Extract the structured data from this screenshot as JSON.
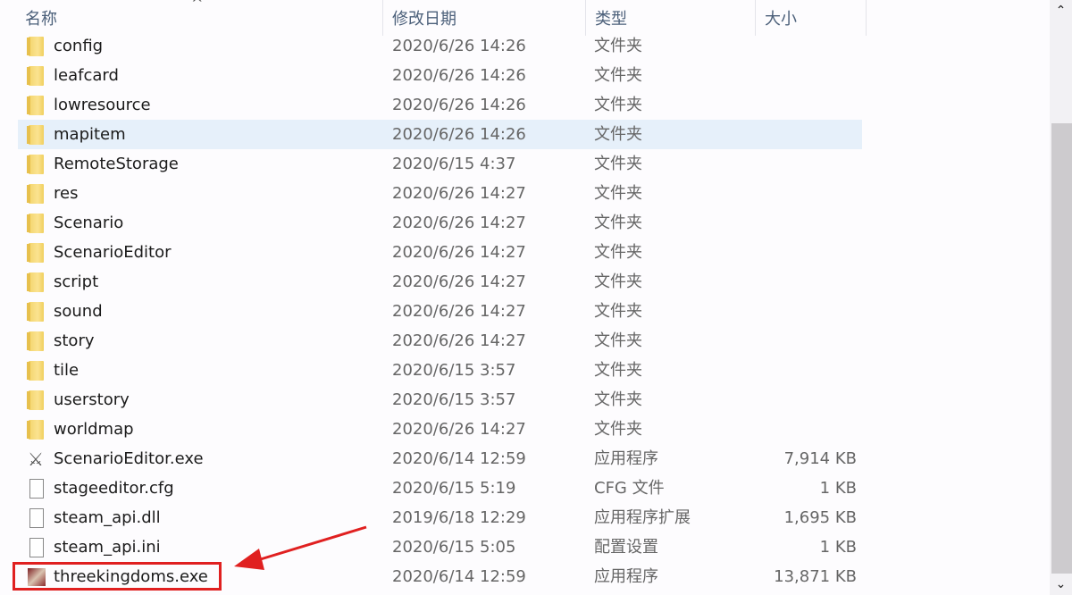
{
  "columns": {
    "name": "名称",
    "date": "修改日期",
    "type": "类型",
    "size": "大小"
  },
  "files": [
    {
      "name": "config",
      "date": "2020/6/26 14:26",
      "type": "文件夹",
      "size": "",
      "icon": "folder-icon"
    },
    {
      "name": "leafcard",
      "date": "2020/6/26 14:26",
      "type": "文件夹",
      "size": "",
      "icon": "folder-icon"
    },
    {
      "name": "lowresource",
      "date": "2020/6/26 14:26",
      "type": "文件夹",
      "size": "",
      "icon": "folder-icon"
    },
    {
      "name": "mapitem",
      "date": "2020/6/26 14:26",
      "type": "文件夹",
      "size": "",
      "icon": "folder-icon"
    },
    {
      "name": "RemoteStorage",
      "date": "2020/6/15 4:37",
      "type": "文件夹",
      "size": "",
      "icon": "folder-icon"
    },
    {
      "name": "res",
      "date": "2020/6/26 14:27",
      "type": "文件夹",
      "size": "",
      "icon": "folder-icon"
    },
    {
      "name": "Scenario",
      "date": "2020/6/26 14:27",
      "type": "文件夹",
      "size": "",
      "icon": "folder-icon"
    },
    {
      "name": "ScenarioEditor",
      "date": "2020/6/26 14:27",
      "type": "文件夹",
      "size": "",
      "icon": "folder-icon"
    },
    {
      "name": "script",
      "date": "2020/6/26 14:27",
      "type": "文件夹",
      "size": "",
      "icon": "folder-icon"
    },
    {
      "name": "sound",
      "date": "2020/6/26 14:27",
      "type": "文件夹",
      "size": "",
      "icon": "folder-icon"
    },
    {
      "name": "story",
      "date": "2020/6/26 14:27",
      "type": "文件夹",
      "size": "",
      "icon": "folder-icon"
    },
    {
      "name": "tile",
      "date": "2020/6/15 3:57",
      "type": "文件夹",
      "size": "",
      "icon": "folder-icon"
    },
    {
      "name": "userstory",
      "date": "2020/6/15 3:57",
      "type": "文件夹",
      "size": "",
      "icon": "folder-icon"
    },
    {
      "name": "worldmap",
      "date": "2020/6/26 14:27",
      "type": "文件夹",
      "size": "",
      "icon": "folder-icon"
    },
    {
      "name": "ScenarioEditor.exe",
      "date": "2020/6/14 12:59",
      "type": "应用程序",
      "size": "7,914 KB",
      "icon": "tools-exe-icon"
    },
    {
      "name": "stageeditor.cfg",
      "date": "2020/6/15 5:19",
      "type": "CFG 文件",
      "size": "1 KB",
      "icon": "file-icon"
    },
    {
      "name": "steam_api.dll",
      "date": "2019/6/18 12:29",
      "type": "应用程序扩展",
      "size": "1,695 KB",
      "icon": "dll-file-icon"
    },
    {
      "name": "steam_api.ini",
      "date": "2020/6/15 5:05",
      "type": "配置设置",
      "size": "1 KB",
      "icon": "settings-file-icon"
    },
    {
      "name": "threekingdoms.exe",
      "date": "2020/6/14 12:59",
      "type": "应用程序",
      "size": "13,871 KB",
      "icon": "game-exe-icon"
    }
  ],
  "hovered_row": "mapitem",
  "annotation": {
    "highlighted_file": "threekingdoms.exe",
    "color": "#e02020"
  },
  "colors": {
    "hover_row": "#e6f0fa",
    "header_text": "#4c607a"
  }
}
